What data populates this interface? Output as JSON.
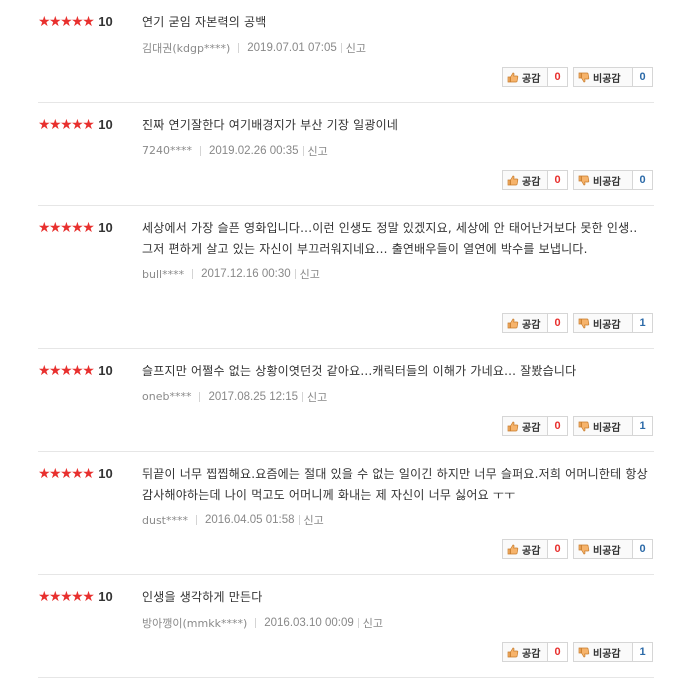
{
  "labels": {
    "agree": "공감",
    "disagree": "비공감",
    "report": "신고"
  },
  "colors": {
    "star": "#e8302e",
    "agree_count": "#e8302e",
    "disagree_count": "#2c6aa8"
  },
  "reviews": [
    {
      "stars": "★★★★★",
      "score": "10",
      "text": "연기 굳임 자본력의 공백",
      "author": "김대권(kdgp****)",
      "date": "2019.07.01 07:05",
      "agree": "0",
      "disagree": "0"
    },
    {
      "stars": "★★★★★",
      "score": "10",
      "text": "진짜 연기잘한다 여기배경지가 부산 기장 일광이네",
      "author": "7240****",
      "date": "2019.02.26 00:35",
      "agree": "0",
      "disagree": "0"
    },
    {
      "stars": "★★★★★",
      "score": "10",
      "text": "세상에서 가장 슬픈 영화입니다...이런 인생도 정말 있겠지요, 세상에 안 태어난거보다 못한 인생.. 그저 편하게 살고 있는 자신이 부끄러워지네요... 출연배우들이 열연에 박수를 보냅니다.",
      "author": "bull****",
      "date": "2017.12.16 00:30",
      "agree": "0",
      "disagree": "1"
    },
    {
      "stars": "★★★★★",
      "score": "10",
      "text": "슬프지만 어쩔수 없는 상황이엿던것 같아요...캐릭터들의 이해가 가네요... 잘봤습니다",
      "author": "oneb****",
      "date": "2017.08.25 12:15",
      "agree": "0",
      "disagree": "1"
    },
    {
      "stars": "★★★★★",
      "score": "10",
      "text": "뒤끝이 너무 찝찝해요.요즘에는 절대 있을 수 없는 일이긴 하지만 너무 슬퍼요.저희 어머니한테 항상 감사해야하는데 나이 먹고도 어머니께 화내는 제 자신이 너무 싫어요 ㅜㅜ",
      "author": "dust****",
      "date": "2016.04.05 01:58",
      "agree": "0",
      "disagree": "0"
    },
    {
      "stars": "★★★★★",
      "score": "10",
      "text": "인생을 생각하게 만든다",
      "author": "방아깽이(mmkk****)",
      "date": "2016.03.10 00:09",
      "agree": "0",
      "disagree": "1"
    }
  ]
}
